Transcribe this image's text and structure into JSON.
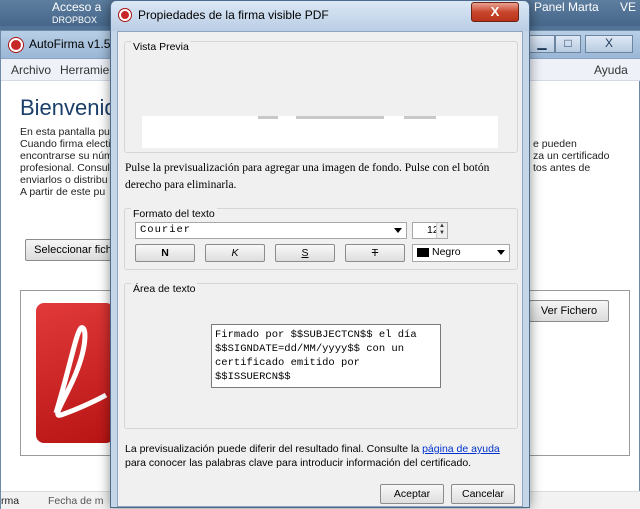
{
  "taskbar": {
    "item1": "Acceso a",
    "item1b": "DROPBOX",
    "item2": "Panel Marta",
    "item3": "VE"
  },
  "background_window": {
    "title": "AutoFirma v1.5",
    "controls": {
      "minimize": "▁",
      "maximize": "□",
      "close": "X"
    },
    "menu": {
      "archivo": "Archivo",
      "herramientas": "Herramie",
      "ayuda": "Ayuda"
    },
    "heading": "Bienvenid",
    "text_lines": [
      "En esta pantalla pu",
      "Cuando firma electi",
      "encontrarse su núm",
      "profesional. Consul",
      "enviarlos o distribu",
      "A partir de este pu"
    ],
    "text_right_lines": [
      "e pueden",
      "za un certificado",
      "tos antes de"
    ],
    "select_file_button": "Seleccionar fich",
    "view_file_button": "Ver Fichero",
    "footer_left": "rma",
    "footer_date": "Fecha de m"
  },
  "dialog": {
    "title": "Propiedades de la firma visible PDF",
    "close": "X",
    "preview": {
      "label": "Vista Previa"
    },
    "hint_line1": "Pulse la previsualización para agregar una imagen de fondo. Pulse con el botón",
    "hint_line2": "derecho para eliminarla.",
    "text_format": {
      "label": "Formato del texto",
      "font": "Courier",
      "size": "12",
      "bold": "N",
      "italic": "K",
      "underline": "S",
      "strike": "T",
      "color": "Negro"
    },
    "text_area": {
      "label": "Área de texto",
      "value": "Firmado por $$SUBJECTCN$$ el día\n$$SIGNDATE=dd/MM/yyyy$$ con un\ncertificado emitido por\n$$ISSUERCN$$"
    },
    "help": {
      "part1": "La previsualización puede diferir del resultado final. Consulte la ",
      "link": "página de ayuda",
      "part2": "para conocer las palabras clave para introducir información del certificado."
    },
    "accept_button": "Aceptar",
    "cancel_button": "Cancelar"
  },
  "colors": {
    "title_gradient_top": "#dbe8f6",
    "close_red": "#c9462c",
    "heading_blue": "#1b3f6a",
    "link_blue": "#0033cc"
  }
}
